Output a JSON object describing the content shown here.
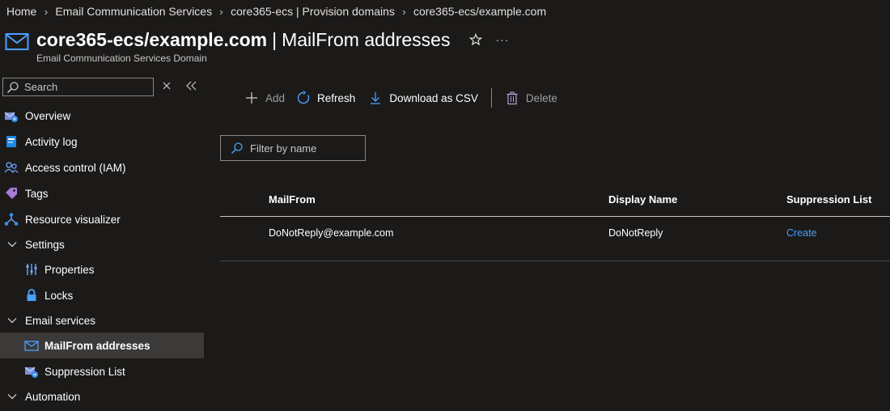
{
  "breadcrumb": [
    "Home",
    "Email Communication Services",
    "core365-ecs | Provision domains",
    "core365-ecs/example.com"
  ],
  "header": {
    "title": "core365-ecs/example.com",
    "separator": "|",
    "section": "MailFrom addresses",
    "subtitle": "Email Communication Services Domain",
    "more": "···"
  },
  "sidebar": {
    "search_placeholder": "Search",
    "items": [
      {
        "label": "Overview",
        "icon": "overview-icon"
      },
      {
        "label": "Activity log",
        "icon": "activity-log-icon"
      },
      {
        "label": "Access control (IAM)",
        "icon": "people-icon"
      },
      {
        "label": "Tags",
        "icon": "tag-icon"
      },
      {
        "label": "Resource visualizer",
        "icon": "hierarchy-icon"
      },
      {
        "label": "Settings",
        "icon": "chevron-down-icon"
      },
      {
        "label": "Properties",
        "icon": "sliders-icon"
      },
      {
        "label": "Locks",
        "icon": "lock-icon"
      },
      {
        "label": "Email services",
        "icon": "chevron-down-icon"
      },
      {
        "label": "MailFrom addresses",
        "icon": "envelope-icon"
      },
      {
        "label": "Suppression List",
        "icon": "suppression-icon"
      },
      {
        "label": "Automation",
        "icon": "chevron-down-icon"
      }
    ]
  },
  "toolbar": {
    "add": "Add",
    "refresh": "Refresh",
    "download": "Download as CSV",
    "delete": "Delete"
  },
  "filter": {
    "placeholder": "Filter by name"
  },
  "table": {
    "columns": [
      "MailFrom",
      "Display Name",
      "Suppression List"
    ],
    "rows": [
      {
        "mailfrom": "DoNotReply@example.com",
        "display_name": "DoNotReply",
        "suppression": "Create"
      }
    ]
  },
  "colors": {
    "background": "#1b1a19",
    "accent": "#479ef5",
    "active_item": "#3b3a39"
  }
}
